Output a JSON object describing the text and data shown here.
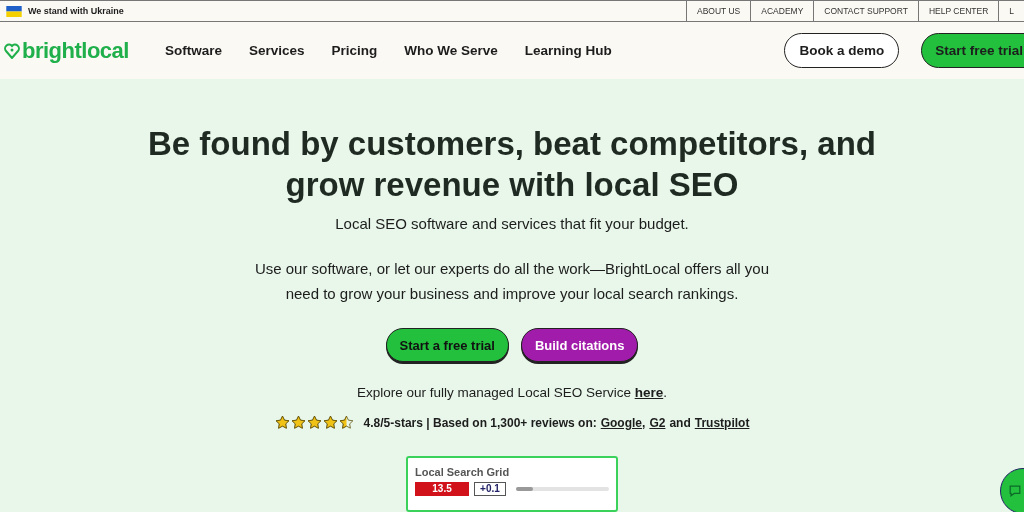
{
  "topbar": {
    "notice": "We stand with Ukraine",
    "links": [
      "ABOUT US",
      "ACADEMY",
      "CONTACT SUPPORT",
      "HELP CENTER",
      "L"
    ]
  },
  "nav": {
    "logo": "brightlocal",
    "items": [
      "Software",
      "Services",
      "Pricing",
      "Who We Serve",
      "Learning Hub"
    ],
    "demo_button": "Book a demo",
    "trial_button": "Start free trial"
  },
  "hero": {
    "title": "Be found by customers, beat competitors, and grow revenue with local SEO",
    "subtitle": "Local SEO software and services that fit your budget.",
    "description": "Use our software, or let our experts do all the work—BrightLocal offers all you need to grow your business and improve your local search rankings.",
    "buttons": [
      {
        "label": "Start a free trial",
        "kind": "primary"
      },
      {
        "label": "Build citations",
        "kind": "secondary"
      }
    ],
    "explore_text": "Explore our fully managed Local SEO Service",
    "explore_link": "here",
    "explore_end": ".",
    "rating": {
      "stars": 4.5,
      "text": "4.8/5-stars | Based on 1,300+ reviews on:",
      "links": [
        {
          "label": "Google",
          "after": ","
        },
        {
          "label": "G2",
          "after": "and"
        },
        {
          "label": "Trustpilot"
        }
      ]
    },
    "card": {
      "title": "Local Search Grid",
      "score": "13.5",
      "change": "+0.1",
      "level": 0.18
    }
  }
}
